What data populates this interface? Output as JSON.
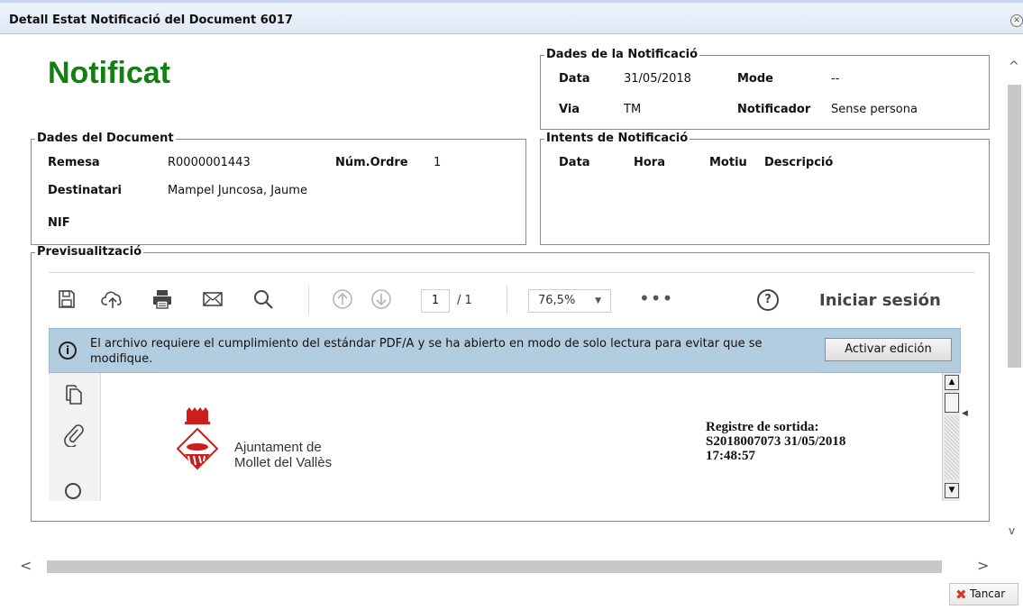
{
  "window": {
    "title": "Detall Estat Notificació del Document 6017",
    "close_glyph": "✕"
  },
  "status": {
    "text": "Notificat",
    "color": "#118011"
  },
  "notification": {
    "legend": "Dades de la Notificació",
    "data_label": "Data",
    "data_value": "31/05/2018",
    "mode_label": "Mode",
    "mode_value": "--",
    "via_label": "Via",
    "via_value": "TM",
    "notificador_label": "Notificador",
    "notificador_value": "Sense persona"
  },
  "document": {
    "legend": "Dades del Document",
    "remesa_label": "Remesa",
    "remesa_value": "R0000001443",
    "ordre_label": "Núm.Ordre",
    "ordre_value": "1",
    "destinatari_label": "Destinatari",
    "destinatari_value": "Mampel Juncosa, Jaume",
    "nif_label": "NIF",
    "nif_value": ""
  },
  "attempts": {
    "legend": "Intents de Notificació",
    "columns": [
      "Data",
      "Hora",
      "Motiu",
      "Descripció"
    ]
  },
  "preview": {
    "legend": "Previsualització",
    "toolbar": {
      "icons": [
        "save-icon",
        "upload-icon",
        "print-icon",
        "mail-icon",
        "search-icon",
        "page-up-icon",
        "page-down-icon"
      ],
      "page_current": "1",
      "page_total": "/ 1",
      "zoom": "76,5%",
      "more": "•••",
      "help": "?",
      "signin": "Iniciar sesión"
    },
    "info_bar": {
      "icon": "i",
      "text": "El archivo requiere el cumplimiento del estándar PDF/A y se ha abierto en modo de solo lectura para evitar que se modifique.",
      "button": "Activar edición"
    },
    "document": {
      "org_line1": "Ajuntament de",
      "org_line2": "Mollet del Vallès",
      "registre_line1": "Registre de sortida:",
      "registre_line2": "S2018007073 31/05/2018",
      "registre_line3": "17:48:57"
    }
  },
  "footer": {
    "cancel_label": "Tancar"
  },
  "colors": {
    "accent_green": "#118011",
    "info_bar": "#b3cde0",
    "cancel_red": "#d43a2a"
  }
}
